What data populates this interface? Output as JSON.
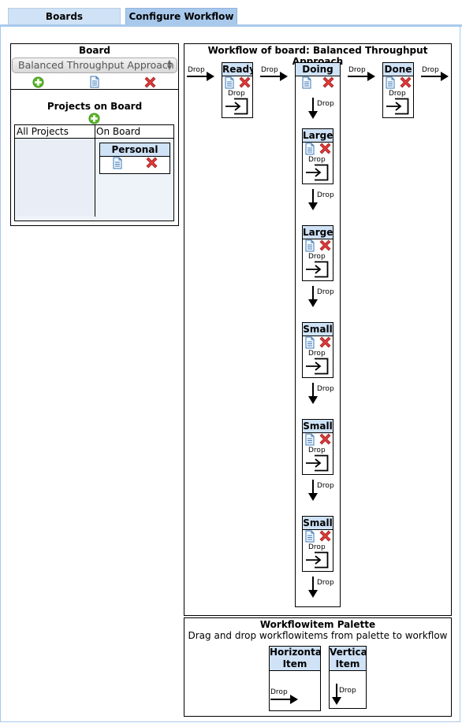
{
  "tabs": [
    {
      "label": "Boards"
    },
    {
      "label": "Configure Workflow"
    }
  ],
  "board_panel": {
    "title": "Board",
    "selected_board": "Balanced Throughput Approach",
    "projects_title": "Projects on Board",
    "col_all": "All Projects",
    "col_on": "On Board",
    "project_name": "Personal"
  },
  "workflow": {
    "title": "Workflow of board: Balanced Throughput Approach",
    "drop_label": "Drop",
    "ready": "Ready",
    "doing": "Doing",
    "done": "Done",
    "sub_items": [
      "Large",
      "Large",
      "Small",
      "Small",
      "Small"
    ]
  },
  "palette": {
    "title": "Workflowitem Palette",
    "hint": "Drag and drop workflowitems from palette to workflow",
    "horizontal_line1": "Horizontal",
    "horizontal_line2": "Item",
    "vertical_line1": "Vertical",
    "vertical_line2": "Item",
    "drop_label": "Drop"
  },
  "icons": {
    "add": "add-icon",
    "edit": "document-icon",
    "delete": "delete-icon"
  },
  "colors": {
    "header_bg": "#cfe2f6",
    "tab_active": "#a9c9ec",
    "add_green": "#5cb82a",
    "delete_red": "#d62c2c"
  }
}
